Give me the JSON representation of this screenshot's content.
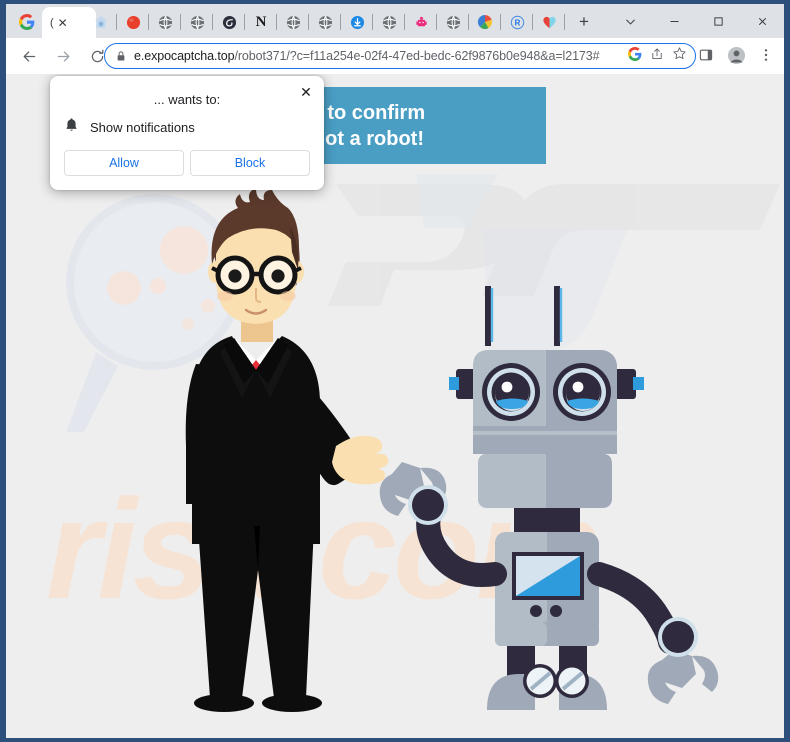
{
  "window": {
    "controls": [
      {
        "name": "tab-search-button",
        "glyph": "⌄"
      },
      {
        "name": "minimize-button",
        "glyph": "–"
      },
      {
        "name": "maximize-button",
        "glyph": "▢"
      },
      {
        "name": "close-window-button",
        "glyph": "✕"
      }
    ]
  },
  "tabstrip": {
    "pinned_tabs": [
      {
        "icon": "google-favicon",
        "color": "#4285f4"
      },
      {
        "icon": "house-favicon",
        "color": "#c7dcef"
      },
      {
        "icon": "red-circle-favicon",
        "color": "#e8402a"
      },
      {
        "icon": "globe-favicon",
        "color": "#5f6368"
      },
      {
        "icon": "globe-favicon",
        "color": "#5f6368"
      },
      {
        "icon": "spiral-favicon",
        "color": "#2b2e3b"
      },
      {
        "icon": "letter-n-favicon",
        "color": "#1a1a1a"
      },
      {
        "icon": "globe-favicon",
        "color": "#5f6368"
      },
      {
        "icon": "globe-favicon",
        "color": "#5f6368"
      },
      {
        "icon": "download-blue-favicon",
        "color": "#1e88e5"
      },
      {
        "icon": "globe-favicon",
        "color": "#5f6368"
      },
      {
        "icon": "pink-robot-favicon",
        "color": "#ec2a7b"
      },
      {
        "icon": "globe-favicon",
        "color": "#5f6368"
      },
      {
        "icon": "color-wheel-favicon",
        "color": "#e84f3d"
      },
      {
        "icon": "letter-r-favicon",
        "color": "#1a73e8"
      },
      {
        "icon": "heart-favicon",
        "color": "#e8403a"
      }
    ],
    "active_tab": {
      "title": "(",
      "close_glyph": "✕"
    },
    "new_tab_label": "+"
  },
  "toolbar": {
    "back_label": "←",
    "forward_label": "→",
    "reload_label": "⟳",
    "url_host": "e.expocaptcha.top",
    "url_path": "/robot371/?c=f11a254e-02f4-47ed-bedc-62f9876b0e948&a=l2173#",
    "url_full": "e.expocaptcha.top/robot371/?c=f11a254e-02f4-47ed-bedc-62f9876b0e948&a=l2173#",
    "lock_icon": "lock-icon",
    "omnibox_actions": [
      {
        "name": "google-lens-icon"
      },
      {
        "name": "share-icon"
      },
      {
        "name": "bookmark-star-icon"
      }
    ],
    "right_actions": [
      {
        "name": "side-panel-icon"
      },
      {
        "name": "profile-avatar-icon"
      },
      {
        "name": "chrome-menu-icon"
      }
    ]
  },
  "permission_dialog": {
    "title": "... wants to:",
    "permission_label": "Show notifications",
    "permission_icon": "bell-icon",
    "allow_label": "Allow",
    "block_label": "Block",
    "close_glyph": "✕"
  },
  "page": {
    "banner": {
      "line1": "Click «Allow» to confirm",
      "line2": "that you are not a robot!",
      "background": "#4a9ec4",
      "text_color": "#ffffff"
    },
    "background_color": "#eeeeee",
    "watermarks": [
      {
        "name": "pc-watermark",
        "text": "PC",
        "color": "#e4e4e4"
      },
      {
        "name": "risk-com-watermark",
        "text": "risk.com",
        "color": "#f6e2d2"
      },
      {
        "name": "magnifying-glass-watermark",
        "color": "#e3e6ec"
      }
    ],
    "illustration": {
      "man": {
        "name": "businessman-illustration",
        "suit_color": "#0d0d0d",
        "skin_color": "#f7d9a8",
        "hair_color": "#5b3a2b",
        "tie_color": "#e8303a",
        "shirt_color": "#ffffff",
        "glasses_color": "#141414"
      },
      "robot": {
        "name": "robot-illustration",
        "body_color": "#9fa9b7",
        "body_light": "#b6bfca",
        "dark_color": "#2f2a3d",
        "screen_color": "#2e9bdd",
        "accent_blue": "#2e9bdd",
        "eye_ring": "#cfe0ea"
      }
    }
  }
}
